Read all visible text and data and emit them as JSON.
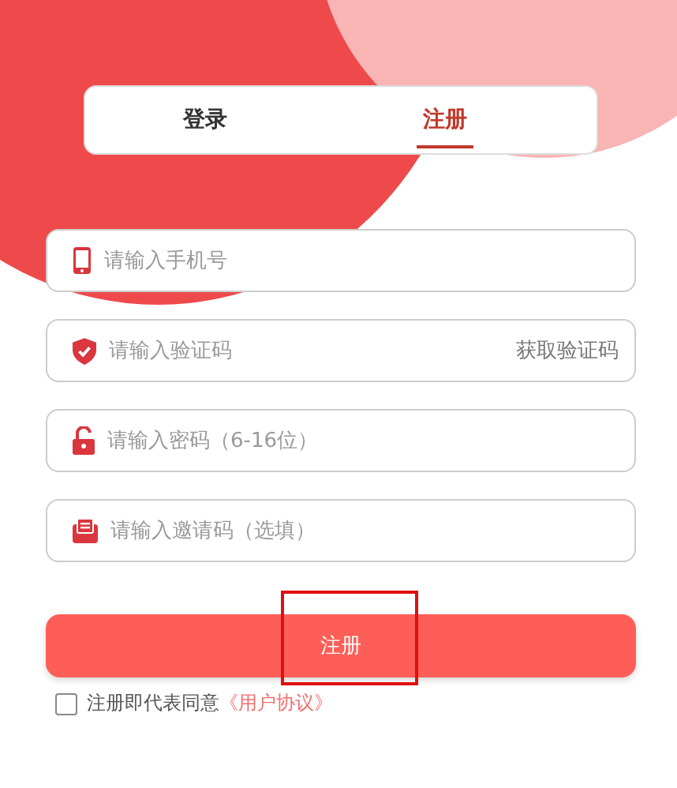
{
  "tabs": [
    {
      "label": "登录",
      "selected": false
    },
    {
      "label": "注册",
      "selected": true
    }
  ],
  "fields": [
    {
      "kind": "phone",
      "placeholder": "请输入手机号"
    },
    {
      "kind": "code",
      "placeholder": "请输入验证码",
      "action": "获取验证码"
    },
    {
      "kind": "password",
      "placeholder": "请输入密码（6-16位）"
    },
    {
      "kind": "invite",
      "placeholder": "请输入邀请码（选填）"
    }
  ],
  "submit": "注册",
  "agreement": {
    "checked": false,
    "text": "注册即代表同意",
    "link": "《用户协议》"
  }
}
